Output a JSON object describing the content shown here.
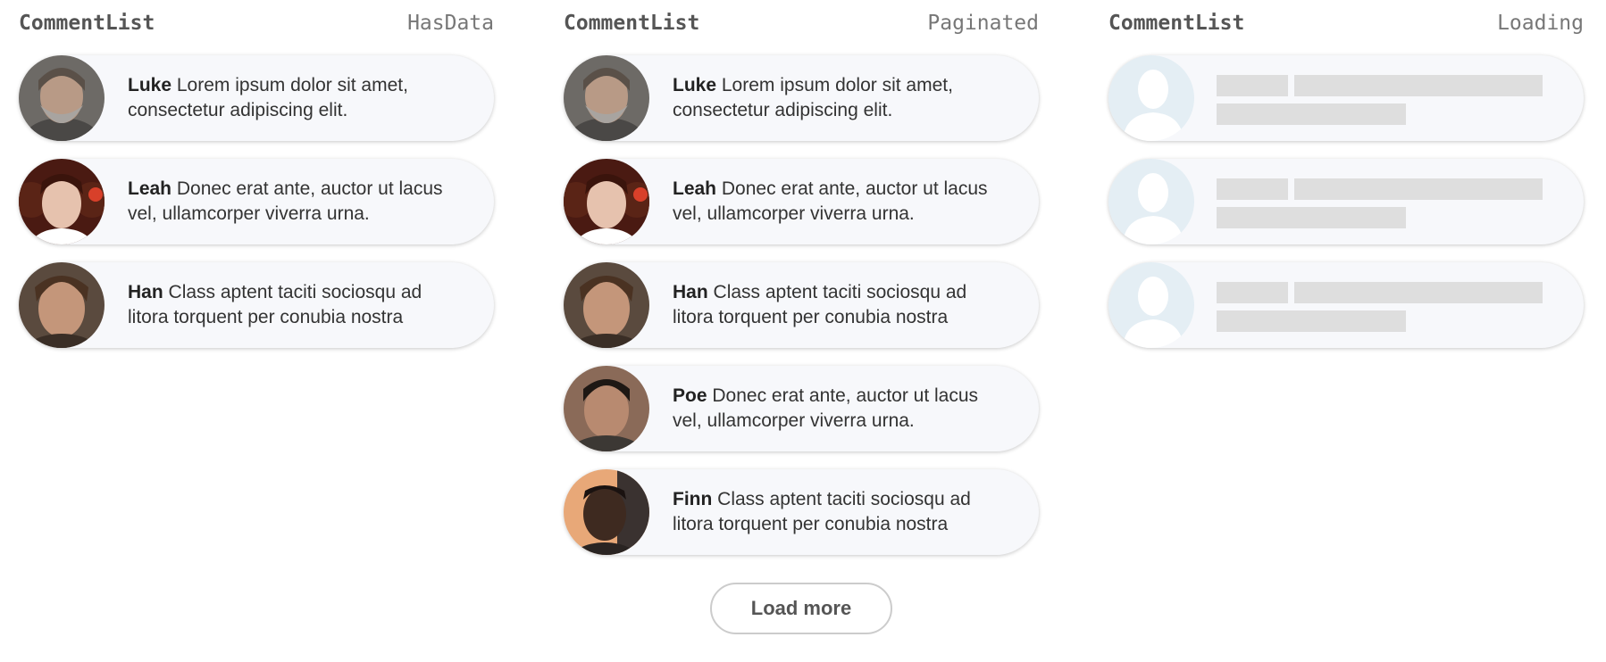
{
  "columns": [
    {
      "title": "CommentList",
      "state": "HasData",
      "comments": [
        {
          "author": "Luke",
          "text": "Lorem ipsum dolor sit amet, consectetur adipiscing elit."
        },
        {
          "author": "Leah",
          "text": "Donec erat ante, auctor ut lacus vel, ullamcorper viverra urna."
        },
        {
          "author": "Han",
          "text": "Class aptent taciti sociosqu ad litora torquent per conubia nostra"
        }
      ]
    },
    {
      "title": "CommentList",
      "state": "Paginated",
      "comments": [
        {
          "author": "Luke",
          "text": "Lorem ipsum dolor sit amet, consectetur adipiscing elit."
        },
        {
          "author": "Leah",
          "text": "Donec erat ante, auctor ut lacus vel, ullamcorper viverra urna."
        },
        {
          "author": "Han",
          "text": "Class aptent taciti sociosqu ad litora torquent per conubia nostra"
        },
        {
          "author": "Poe",
          "text": "Donec erat ante, auctor ut lacus vel, ullamcorper viverra urna."
        },
        {
          "author": "Finn",
          "text": "Class aptent taciti sociosqu ad litora torquent per conubia nostra"
        }
      ],
      "load_more_label": "Load more"
    },
    {
      "title": "CommentList",
      "state": "Loading"
    }
  ],
  "colors": {
    "card_bg": "#f7f8fb",
    "skeleton_bar": "#dedede",
    "skeleton_avatar_bg": "#e4eef4",
    "skeleton_avatar_fg": "#ffffff"
  }
}
